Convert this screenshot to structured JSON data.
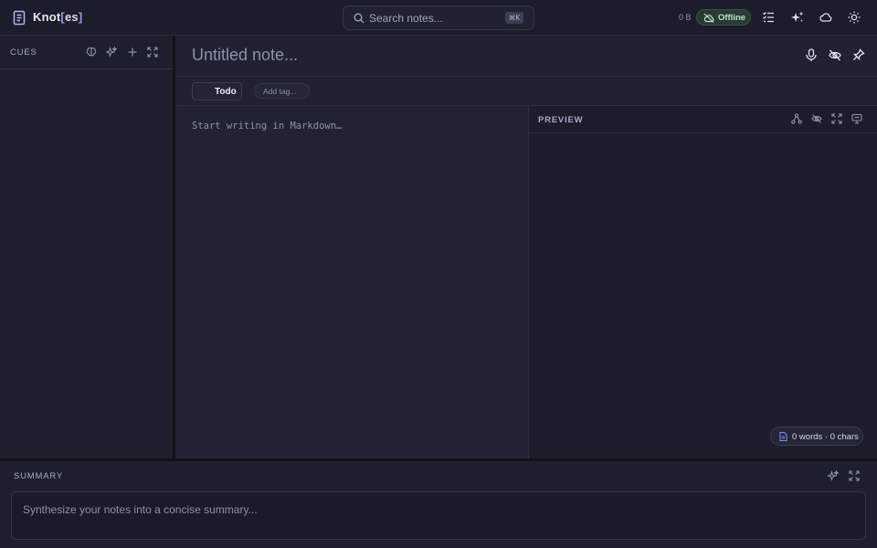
{
  "app": {
    "name": "Knot",
    "name_bracket_open": "[",
    "name_suffix": "es",
    "name_bracket_close": "]"
  },
  "search": {
    "placeholder": "Search notes...",
    "shortcut": "⌘K"
  },
  "status": {
    "storage": "0 B",
    "connection": "Offline"
  },
  "toolbar_icons": [
    "checklist-icon",
    "sparkles-icon",
    "cloud-icon",
    "sun-icon"
  ],
  "cues": {
    "title": "CUES",
    "icons": [
      "brain-icon",
      "sparkles-icon",
      "plus-icon",
      "expand-icon"
    ]
  },
  "note": {
    "title_placeholder": "Untitled note...",
    "tag": "Todo",
    "add_tag_placeholder": "Add tag...",
    "body_placeholder": "Start writing in Markdown…"
  },
  "preview": {
    "title": "PREVIEW",
    "icons": [
      "graph-icon",
      "eye-off-icon",
      "expand-icon",
      "presentation-icon"
    ]
  },
  "stats": {
    "text": "0 words · 0 chars"
  },
  "summary": {
    "title": "SUMMARY",
    "placeholder": "Synthesize your notes into a concise summary..."
  },
  "colors": {
    "background": "#1d1d2b",
    "accent": "#8f9be6",
    "offline_bg": "#2b3a33",
    "offline_text": "#b7e3c6"
  }
}
